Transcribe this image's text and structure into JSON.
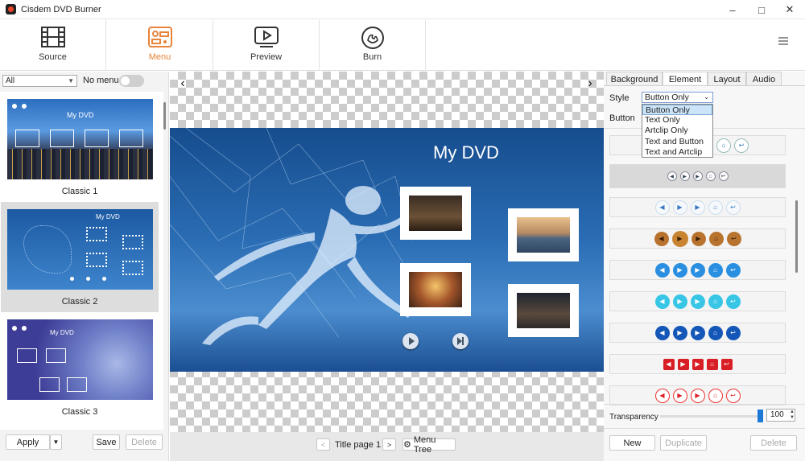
{
  "window": {
    "title": "Cisdem DVD Burner"
  },
  "toolbar": {
    "items": [
      {
        "label": "Source"
      },
      {
        "label": "Menu",
        "active": true
      },
      {
        "label": "Preview"
      },
      {
        "label": "Burn"
      }
    ]
  },
  "left": {
    "filter_value": "All",
    "no_menu_label": "No menu",
    "templates": [
      {
        "name": "Classic 1",
        "preview_title": "My DVD"
      },
      {
        "name": "Classic 2",
        "preview_title": "My DVD",
        "selected": true
      },
      {
        "name": "Classic 3",
        "preview_title": "My DVD"
      }
    ],
    "apply_label": "Apply",
    "save_label": "Save",
    "delete_label": "Delete"
  },
  "center": {
    "menu_title": "My DVD",
    "page_label": "Title page 1",
    "menu_tree_label": "Menu Tree"
  },
  "right": {
    "tabs": [
      "Background",
      "Element",
      "Layout",
      "Audio"
    ],
    "active_tab": "Element",
    "style_label": "Style",
    "style_value": "Button Only",
    "style_options": [
      "Button Only",
      "Text Only",
      "Artclip Only",
      "Text and Button",
      "Text and Artclip"
    ],
    "button_label": "Button",
    "transparency_label": "Transparency",
    "transparency_value": "100",
    "new_label": "New",
    "duplicate_label": "Duplicate",
    "delete_label": "Delete"
  },
  "colors": {
    "accent": "#e8843b",
    "slider": "#1e78d6"
  }
}
